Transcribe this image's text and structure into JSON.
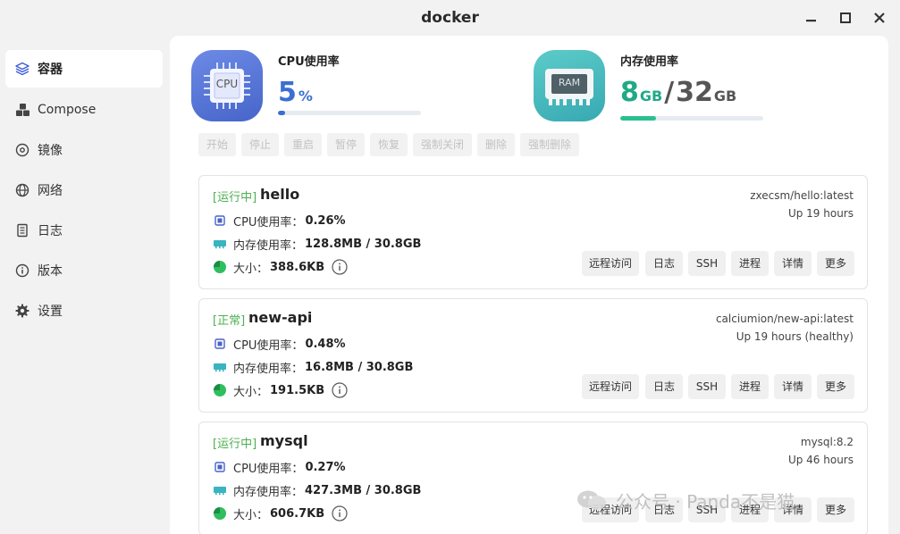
{
  "window": {
    "title": "docker"
  },
  "sidebar": {
    "items": [
      {
        "label": "容器",
        "icon": "layers-icon",
        "active": true
      },
      {
        "label": "Compose",
        "icon": "cubes-icon"
      },
      {
        "label": "镜像",
        "icon": "disc-icon"
      },
      {
        "label": "网络",
        "icon": "globe-icon"
      },
      {
        "label": "日志",
        "icon": "document-icon"
      },
      {
        "label": "版本",
        "icon": "info-icon"
      },
      {
        "label": "设置",
        "icon": "gear-icon"
      }
    ]
  },
  "stats": {
    "cpu": {
      "label": "CPU使用率",
      "value": "5",
      "unit": "%",
      "chip_text": "CPU",
      "percent": 5,
      "color": "#3b6fd1"
    },
    "memory": {
      "label": "内存使用率",
      "used": "8",
      "used_unit": "GB",
      "sep": "/",
      "total": "32",
      "total_unit": "GB",
      "chip_text": "RAM",
      "percent": 25,
      "color": "#2bbf8f"
    }
  },
  "actions": [
    "开始",
    "停止",
    "重启",
    "暂停",
    "恢复",
    "强制关闭",
    "删除",
    "强制删除"
  ],
  "containers": [
    {
      "status": "[运行中]",
      "name": "hello",
      "image": "zxecsm/hello:latest",
      "uptime": "Up 19 hours",
      "cpu_label": "CPU使用率：",
      "cpu": "0.26%",
      "mem_label": "内存使用率：",
      "mem": "128.8MB / 30.8GB",
      "size_label": "大小：",
      "size": "388.6KB"
    },
    {
      "status": "[正常]",
      "name": "new-api",
      "image": "calciumion/new-api:latest",
      "uptime": "Up 19 hours (healthy)",
      "cpu_label": "CPU使用率：",
      "cpu": "0.48%",
      "mem_label": "内存使用率：",
      "mem": "16.8MB / 30.8GB",
      "size_label": "大小：",
      "size": "191.5KB"
    },
    {
      "status": "[运行中]",
      "name": "mysql",
      "image": "mysql:8.2",
      "uptime": "Up 46 hours",
      "cpu_label": "CPU使用率：",
      "cpu": "0.27%",
      "mem_label": "内存使用率：",
      "mem": "427.3MB / 30.8GB",
      "size_label": "大小：",
      "size": "606.7KB"
    }
  ],
  "card_buttons": [
    "远程访问",
    "日志",
    "SSH",
    "进程",
    "详情",
    "更多"
  ],
  "watermark": "公众号 · Panda不是猫",
  "colors": {
    "status_green": "#4caf50",
    "cpu_tile": "#5b79d9",
    "ram_tile": "#3fb5b9"
  }
}
